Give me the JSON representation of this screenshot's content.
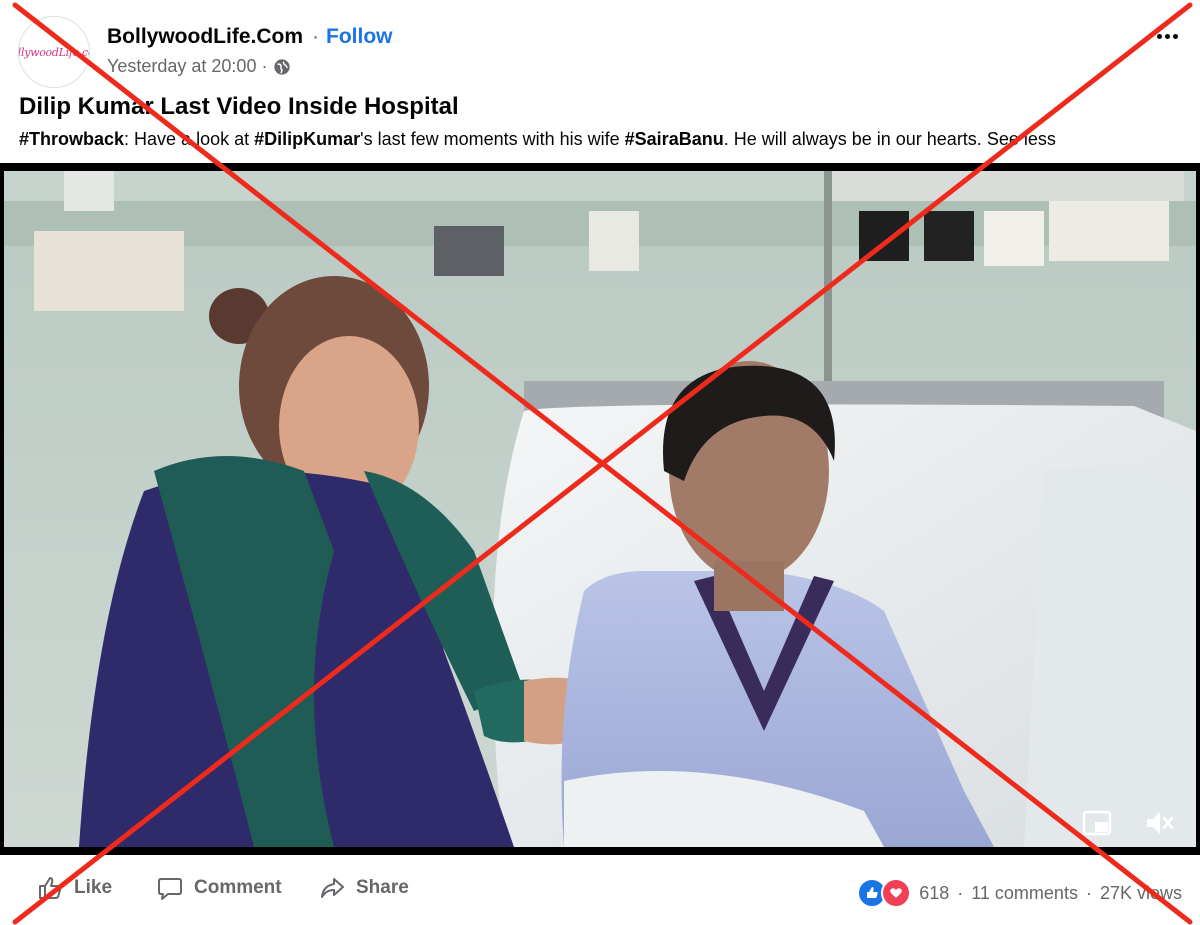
{
  "post": {
    "page_name": "BollywoodLife.Com",
    "separator": "·",
    "follow_label": "Follow",
    "timestamp": "Yesterday at 20:00 ·",
    "avatar_text": "BollywoodLife.com",
    "title": "Dilip Kumar Last Video Inside Hospital",
    "caption": {
      "tag1": "#Throwback",
      "text1": ": Have a look at ",
      "tag2": "#DilipKumar",
      "text2": "'s last few moments with his wife ",
      "tag3": "#SairaBanu",
      "text3": ". He will always be in our hearts. ",
      "see_less": "See less"
    }
  },
  "actions": {
    "like": "Like",
    "comment": "Comment",
    "share": "Share"
  },
  "stats": {
    "reaction_count": "618",
    "comments": "11 comments",
    "sep": "·",
    "views": "27K views"
  },
  "colors": {
    "link_blue": "#1b74e4",
    "muted": "#65676b",
    "cross_red": "#ee2a1c"
  },
  "icons": [
    "globe-icon",
    "more-icon",
    "picture-in-picture-icon",
    "mute-icon",
    "like-icon",
    "comment-icon",
    "share-icon"
  ]
}
